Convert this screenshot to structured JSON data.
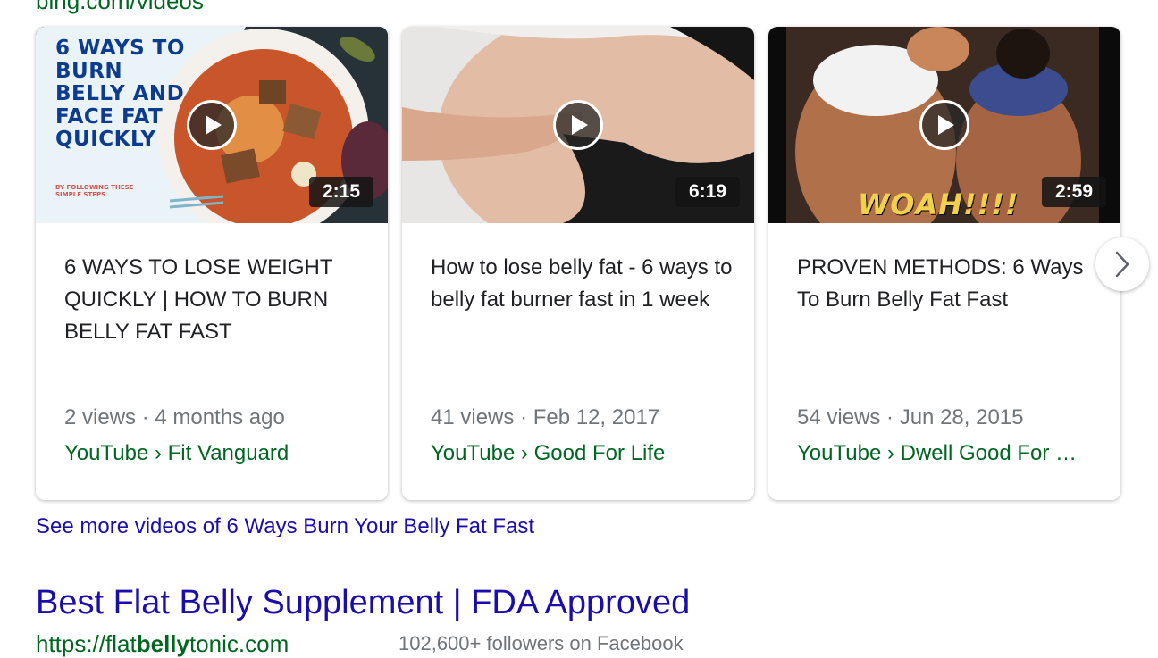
{
  "header": {
    "source": "bing.com/videos"
  },
  "videos": [
    {
      "title": "6 WAYS TO LOSE WEIGHT QUICKLY | HOW TO BURN BELLY FAT FAST",
      "duration": "2:15",
      "meta": "2 views · 4 months ago",
      "channel": "YouTube › Fit Vanguard",
      "thumb_heading": "6 WAYS TO BURN BELLY AND FACE FAT QUICKLY",
      "thumb_sub": "BY FOLLOWING THESE SIMPLE STEPS"
    },
    {
      "title": "How to lose belly fat - 6 ways to belly fat burner fast in 1 week",
      "duration": "6:19",
      "meta": "41 views · Feb 12, 2017",
      "channel": "YouTube › Good For Life"
    },
    {
      "title": "PROVEN METHODS: 6 Ways To Burn Belly Fat Fast",
      "duration": "2:59",
      "meta": "54 views · Jun 28, 2015",
      "channel": "YouTube › Dwell Good For …",
      "thumb_text": "WOAH!!!!"
    }
  ],
  "see_more": "See more videos of 6 Ways Burn Your Belly Fat Fast",
  "next_result": {
    "title": "Best Flat Belly Supplement | FDA Approved",
    "url_prefix": "https://flat",
    "url_bold": "belly",
    "url_suffix": "tonic.com",
    "followers": "102,600+ followers on Facebook"
  },
  "colors": {
    "link_blue": "#1a0dab",
    "url_green": "#006621",
    "meta_gray": "#70757a",
    "title_text": "#202124"
  },
  "icons": [
    "play-icon",
    "chevron-right-icon"
  ]
}
